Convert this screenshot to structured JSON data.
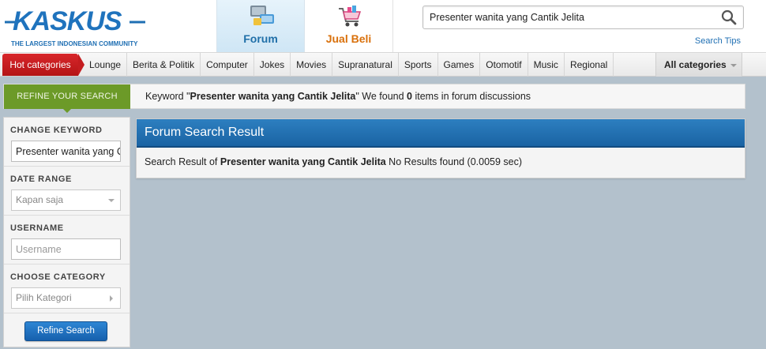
{
  "header": {
    "logo_text": "KASKUS",
    "logo_tagline": "THE LARGEST INDONESIAN COMMUNITY",
    "tabs": [
      {
        "label": "Forum",
        "icon": "forum-chat-icon",
        "active": true
      },
      {
        "label": "Jual Beli",
        "icon": "shopping-cart-icon",
        "active": false
      }
    ],
    "search": {
      "value": "Presenter wanita yang Cantik Jelita",
      "icon": "search-icon"
    },
    "search_tips": "Search Tips"
  },
  "categories": {
    "hot": "Hot categories",
    "items": [
      "Lounge",
      "Berita & Politik",
      "Computer",
      "Jokes",
      "Movies",
      "Supranatural",
      "Sports",
      "Games",
      "Otomotif",
      "Music",
      "Regional"
    ],
    "all": "All categories"
  },
  "refine": {
    "tab_label": "REFINE YOUR SEARCH",
    "summary": {
      "prefix": "Keyword \"",
      "keyword": "Presenter wanita yang Cantik Jelita",
      "mid": "\" We found ",
      "count": "0",
      "suffix": " items in forum discussions"
    }
  },
  "sidebar": {
    "change_keyword": {
      "label": "CHANGE KEYWORD",
      "value": "Presenter wanita yang Cantik Jelita"
    },
    "date_range": {
      "label": "DATE RANGE",
      "selected": "Kapan saja"
    },
    "username": {
      "label": "USERNAME",
      "placeholder": "Username"
    },
    "category": {
      "label": "CHOOSE CATEGORY",
      "selected": "Pilih Kategori"
    },
    "button": "Refine Search"
  },
  "result": {
    "title": "Forum Search Result",
    "prefix": "Search Result of ",
    "keyword": "Presenter wanita yang Cantik Jelita",
    "suffix": " No Results found (0.0059 sec)"
  },
  "colors": {
    "hot_red": "#c41d20",
    "refine_green": "#6c9a28",
    "result_blue": "#2370b3",
    "link_blue": "#1f6fb3",
    "jual_orange": "#d9700b"
  }
}
